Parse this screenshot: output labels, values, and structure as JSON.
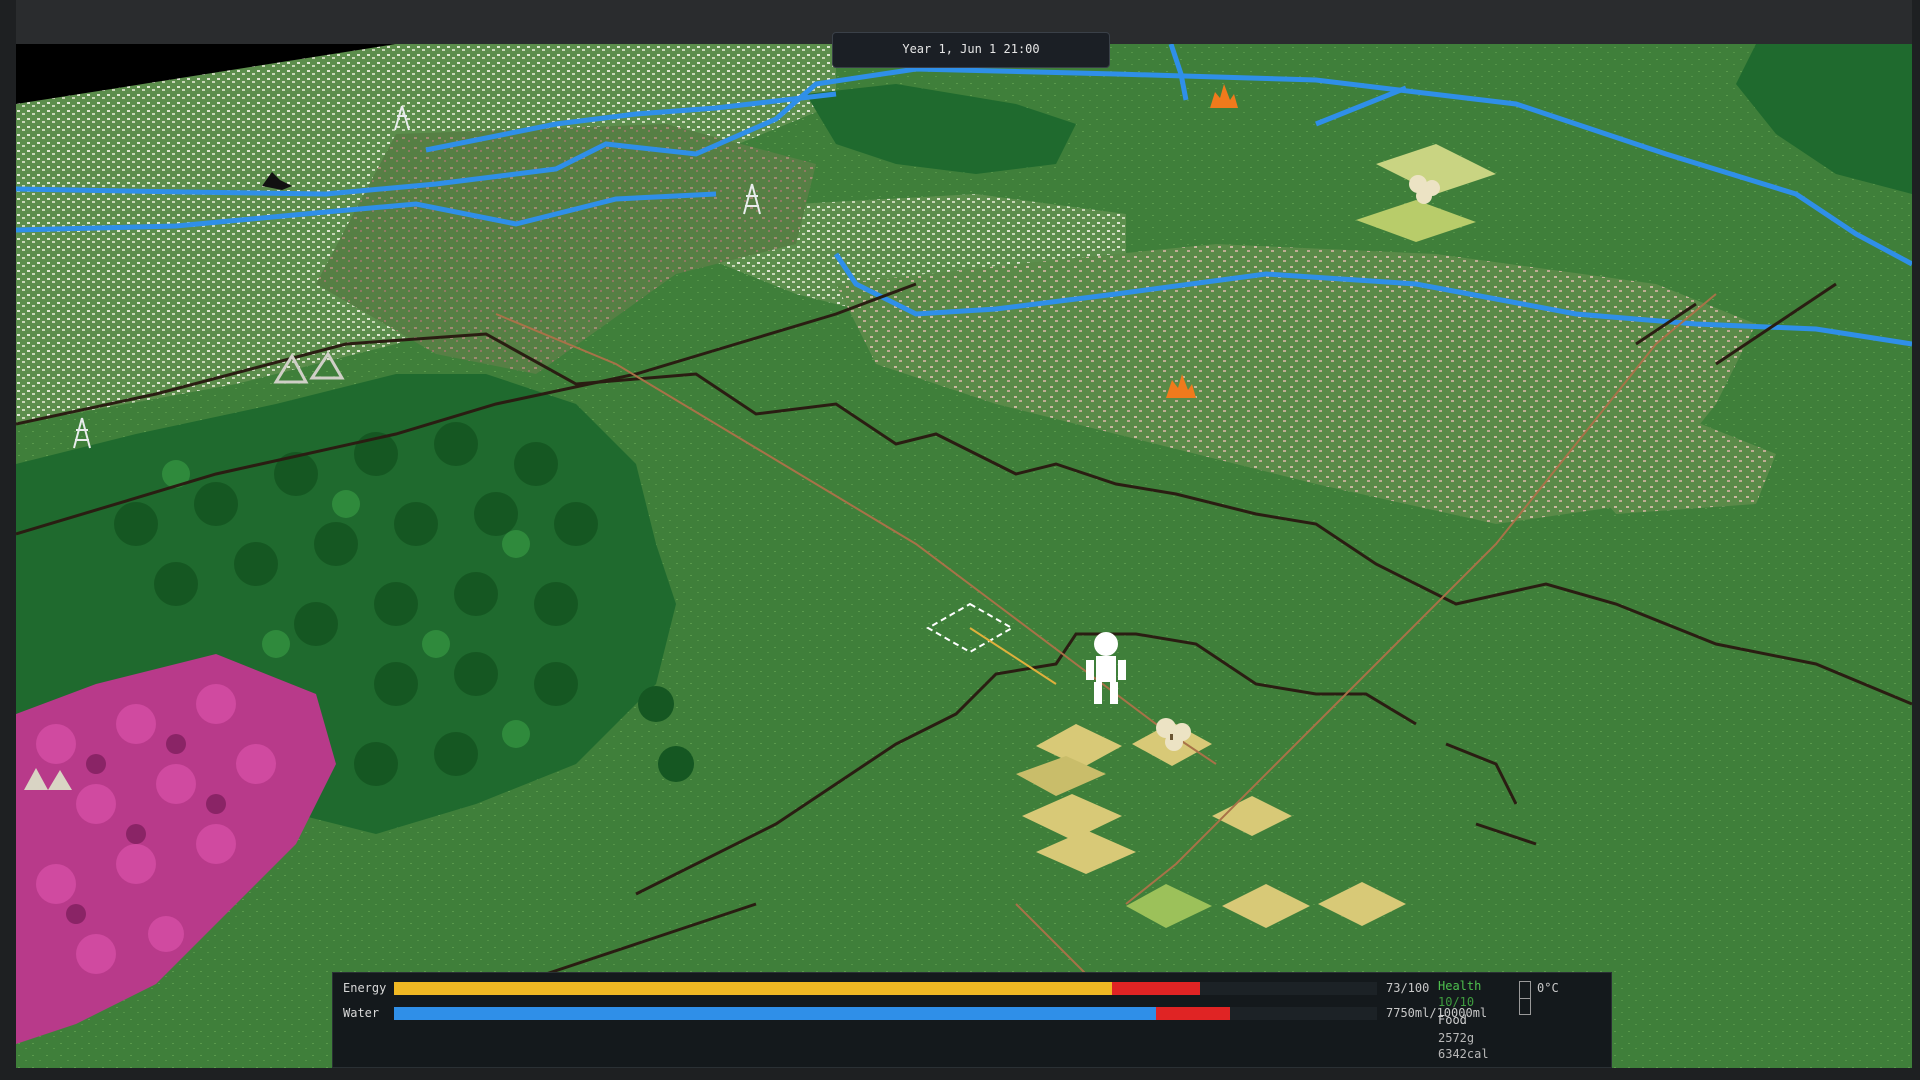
{
  "clock": {
    "text": "Year 1, Jun 1  21:00"
  },
  "hud": {
    "energy": {
      "label": "Energy",
      "value_text": "73/100",
      "fraction": 0.73,
      "recent_loss_fraction": 0.09,
      "color": "#f0b823"
    },
    "water": {
      "label": "Water",
      "value_text": "7750ml/10000ml",
      "fraction": 0.775,
      "recent_loss_fraction": 0.075,
      "color": "#2f8fe8"
    },
    "health": {
      "label": "Health",
      "value_text": "10/10"
    },
    "food": {
      "label": "Food",
      "grams": "2572g",
      "calories": "6342cal"
    },
    "temperature": {
      "value_text": "0°C"
    }
  },
  "map": {
    "player_icon": "person-icon",
    "cursor_icon": "tile-selection-cursor-icon",
    "terrain_colors": {
      "grass": "#3f7f3a",
      "forest": "#1f6a2e",
      "flowers": "#c0398c",
      "river": "#2f8fe8",
      "wheat": "#d8c977",
      "bare_ground": "#b8b08c"
    },
    "markers": [
      "tree-icon",
      "flower-icon",
      "wheat-patch-icon",
      "mushroom-icon",
      "fire-icon",
      "pylon-icon",
      "animal-icon",
      "tent-icon"
    ]
  }
}
